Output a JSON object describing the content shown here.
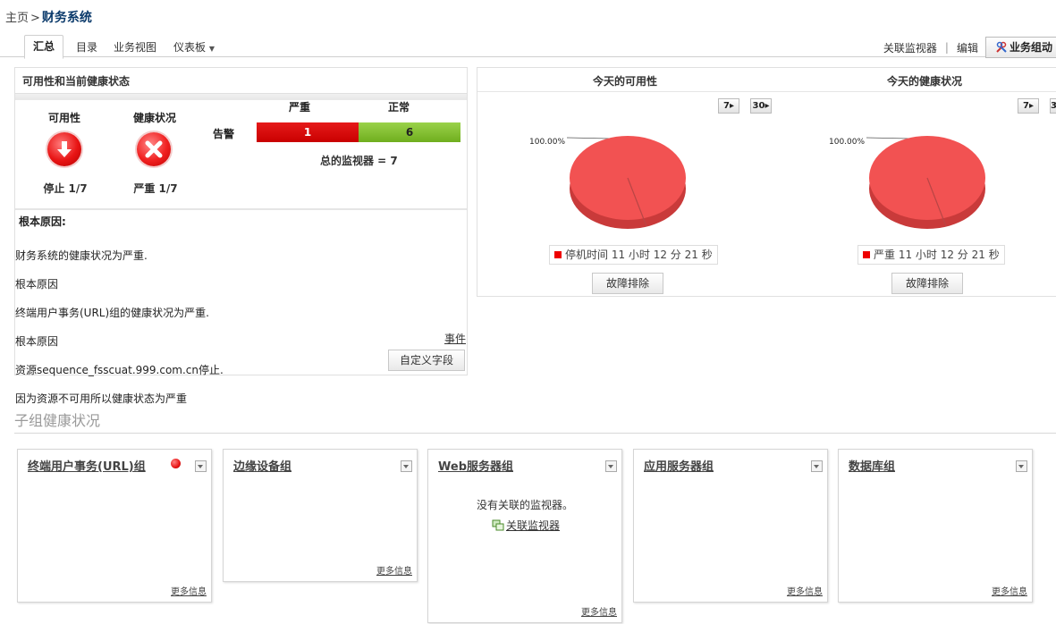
{
  "breadcrumb": {
    "home": "主页",
    "sep": ">",
    "current": "财务系统"
  },
  "tabs": {
    "summary": "汇总",
    "catalog": "目录",
    "biz_view": "业务视图",
    "dashboard": "仪表板"
  },
  "actions": {
    "assoc_monitor": "关联监视器",
    "edit": "编辑",
    "biz_group": "业务组动"
  },
  "availability": {
    "title": "可用性和当前健康状态",
    "avail_label": "可用性",
    "health_label": "健康状况",
    "avail_value": "停止 1/7",
    "health_value": "严重 1/7",
    "alarm_label": "告警",
    "critical_label": "严重",
    "normal_label": "正常",
    "critical_count": "1",
    "normal_count": "6",
    "total": "总的监视器 = 7"
  },
  "root_cause": {
    "title": "根本原因:",
    "lines": [
      "财务系统的健康状况为严重.",
      "根本原因",
      "终端用户事务(URL)组的健康状况为严重.",
      "根本原因",
      "资源sequence_fsscuat.999.com.cn停止.",
      "因为资源不可用所以健康状态为严重"
    ],
    "events_link": "事件",
    "custom_fields_btn": "自定义字段"
  },
  "today": {
    "availability_title": "今天的可用性",
    "health_title": "今天的健康状况",
    "period_7": "7",
    "period_30": "30",
    "pct_label": "100.00%",
    "avail_legend": "停机时间 11 小时 12 分 21 秒",
    "health_legend": "严重 11 小时 12 分 21 秒",
    "troubleshoot": "故障排除"
  },
  "chart_data": [
    {
      "type": "pie",
      "title": "今天的可用性",
      "categories": [
        "停机时间"
      ],
      "values": [
        100.0
      ]
    },
    {
      "type": "pie",
      "title": "今天的健康状况",
      "categories": [
        "严重"
      ],
      "values": [
        100.0
      ]
    }
  ],
  "subgroups": {
    "title": "子组健康状况",
    "more_info": "更多信息",
    "no_monitor": "没有关联的监视器。",
    "assoc_link": "关联监视器",
    "cards": [
      {
        "name": "终端用户事务(URL)组",
        "status_color": "#e81414"
      },
      {
        "name": "边缘设备组"
      },
      {
        "name": "Web服务器组"
      },
      {
        "name": "应用服务器组"
      },
      {
        "name": "数据库组"
      }
    ]
  },
  "colors": {
    "critical": "#dd0000",
    "normal": "#7fbf2a",
    "pie": "#f25252",
    "title_blue": "#0b3a6b"
  }
}
